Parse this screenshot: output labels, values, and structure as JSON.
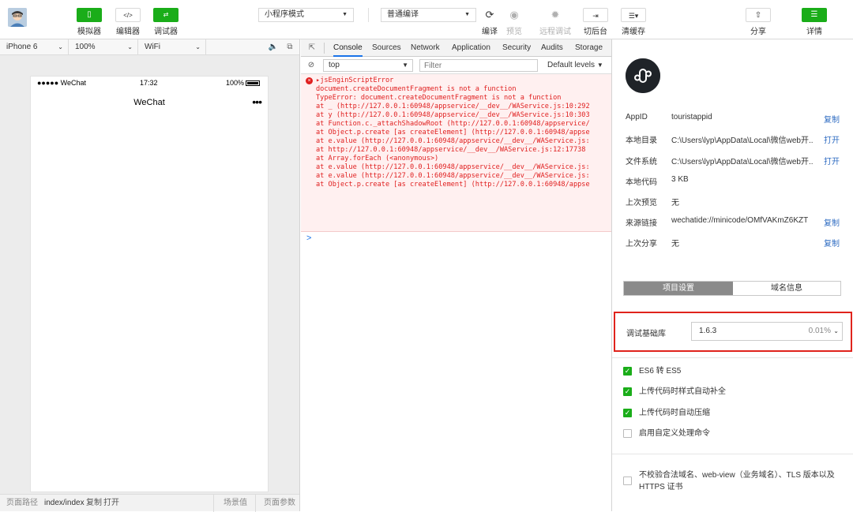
{
  "toolbar": {
    "mode_select": "小程序模式",
    "compile_select": "普通编译",
    "buttons": {
      "simulator": "模拟器",
      "editor": "编辑器",
      "debugger": "调试器",
      "compile": "编译",
      "preview": "预览",
      "remote_debug": "远程调试",
      "background": "切后台",
      "clear_cache": "清缓存",
      "share": "分享",
      "details": "详情"
    }
  },
  "simulator": {
    "device": "iPhone 6",
    "zoom": "100%",
    "network": "WiFi",
    "status": {
      "carrier": "●●●●● WeChat",
      "time": "17:32",
      "battery": "100%"
    },
    "nav_title": "WeChat",
    "nav_more": "•••",
    "footer": {
      "path_label": "页面路径",
      "path_value": "index/index",
      "copy": "复制",
      "open": "打开",
      "scene": "场景值",
      "params": "页面参数"
    }
  },
  "console": {
    "tabs": [
      "Console",
      "Sources",
      "Network",
      "Application",
      "Security",
      "Audits",
      "Storage"
    ],
    "active_tab": "Console",
    "context": "top",
    "filter_placeholder": "Filter",
    "levels": "Default levels",
    "error_title": "jsEnginScriptError",
    "lines": [
      "document.createDocumentFragment is not a function",
      "TypeError: document.createDocumentFragment is not a function",
      "    at _ (http://127.0.0.1:60948/appservice/__dev__/WAService.js:10:292",
      "    at y (http://127.0.0.1:60948/appservice/__dev__/WAService.js:10:303",
      "    at Function.c._attachShadowRoot (http://127.0.0.1:60948/appservice/",
      "    at Object.p.create [as createElement] (http://127.0.0.1:60948/appse",
      "    at e.value (http://127.0.0.1:60948/appservice/__dev__/WAService.js:",
      "    at http://127.0.0.1:60948/appservice/__dev__/WAService.js:12:17738",
      "    at Array.forEach (<anonymous>)",
      "    at e.value (http://127.0.0.1:60948/appservice/__dev__/WAService.js:",
      "    at e.value (http://127.0.0.1:60948/appservice/__dev__/WAService.js:",
      "    at Object.p.create [as createElement] (http://127.0.0.1:60948/appse"
    ],
    "prompt": ">"
  },
  "detail": {
    "rows": [
      {
        "key": "AppID",
        "value": "touristappid",
        "link": "复制"
      },
      {
        "key": "本地目录",
        "value": "C:\\Users\\lyp\\AppData\\Local\\微信web开...",
        "link": "打开"
      },
      {
        "key": "文件系统",
        "value": "C:\\Users\\lyp\\AppData\\Local\\微信web开...",
        "link": "打开"
      },
      {
        "key": "本地代码",
        "value": "3 KB",
        "link": ""
      },
      {
        "key": "上次预览",
        "value": "无",
        "link": ""
      },
      {
        "key": "来源链接",
        "value": "wechatide://minicode/OMfVAKmZ6KZT",
        "link": "复制"
      },
      {
        "key": "上次分享",
        "value": "无",
        "link": "复制"
      }
    ],
    "tabs": {
      "project_settings": "项目设置",
      "domain_info": "域名信息"
    },
    "debug_lib": {
      "label": "调试基础库",
      "version": "1.6.3",
      "percent": "0.01%"
    },
    "options": [
      {
        "label": "ES6 转 ES5",
        "checked": true
      },
      {
        "label": "上传代码时样式自动补全",
        "checked": true
      },
      {
        "label": "上传代码时自动压缩",
        "checked": true
      },
      {
        "label": "启用自定义处理命令",
        "checked": false
      }
    ],
    "domain_option": {
      "label": "不校验合法域名、web-view（业务域名）、TLS 版本以及 HTTPS 证书",
      "checked": false
    }
  },
  "colors": {
    "accent_green": "#1aad19",
    "link_blue": "#2f6cc2",
    "error_red": "#e02020",
    "highlight_red": "#e0231c"
  }
}
